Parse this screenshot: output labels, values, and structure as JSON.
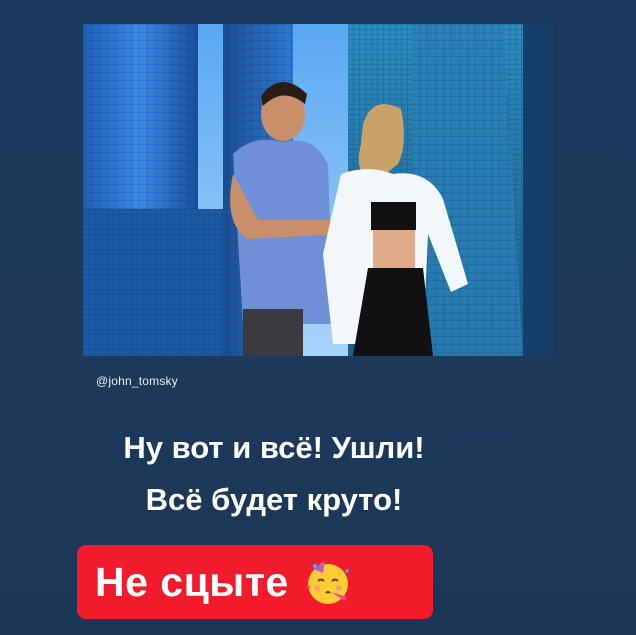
{
  "story": {
    "username": "@john_tomsky",
    "caption_line1": "Ну вот и всё! Ушли!",
    "caption_line2": "Всё будет круто!",
    "sticker_text": "Не сцыте",
    "sticker_emoji": "partying-face-icon"
  },
  "colors": {
    "background": "#1c3a5c",
    "sticker": "#f21b2b",
    "text": "#ffffff"
  }
}
